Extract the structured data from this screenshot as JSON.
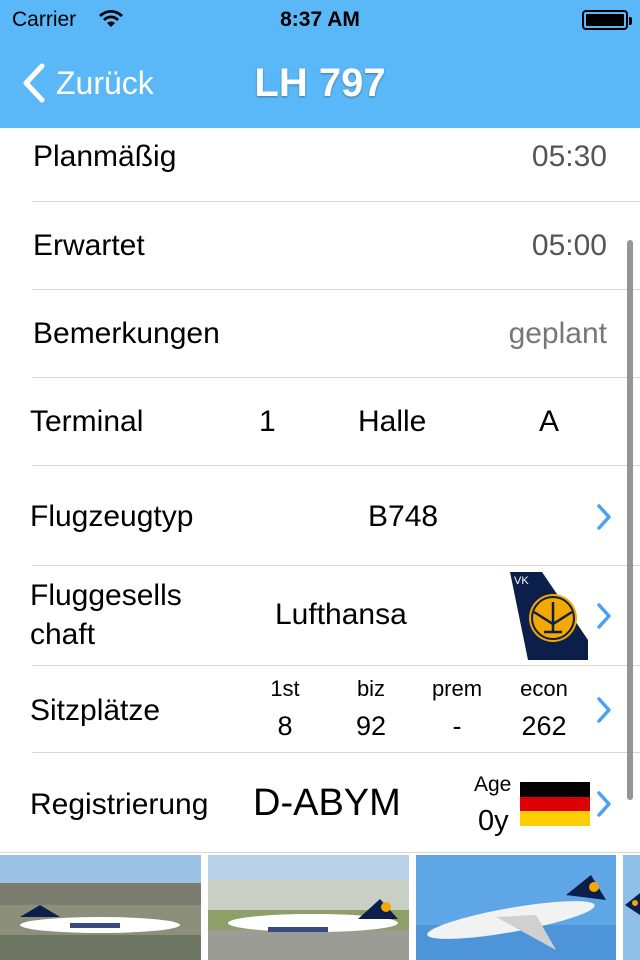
{
  "status_bar": {
    "carrier": "Carrier",
    "time": "8:37 AM"
  },
  "nav": {
    "back_label": "Zurück",
    "title": "LH 797"
  },
  "rows": {
    "scheduled": {
      "label": "Planmäßig",
      "value": "05:30"
    },
    "expected": {
      "label": "Erwartet",
      "value": "05:00"
    },
    "remarks": {
      "label": "Bemerkungen",
      "value": "geplant"
    },
    "terminal": {
      "label": "Terminal",
      "value": "1",
      "hall_label": "Halle",
      "hall_value": "A"
    },
    "aircraft_type": {
      "label": "Flugzeugtyp",
      "value": "B748"
    },
    "airline": {
      "label_line1": "Fluggesells",
      "label_line2": "chaft",
      "value": "Lufthansa"
    },
    "seats": {
      "label": "Sitzplätze",
      "classes": [
        {
          "name": "1st",
          "count": "8"
        },
        {
          "name": "biz",
          "count": "92"
        },
        {
          "name": "prem",
          "count": "-"
        },
        {
          "name": "econ",
          "count": "262"
        }
      ]
    },
    "registration": {
      "label": "Registrierung",
      "value": "D-ABYM",
      "age_label": "Age",
      "age_value": "0y"
    }
  },
  "tail_logo": {
    "tail_text": "VK"
  },
  "icons": {
    "back": "chevron-left-icon",
    "disclosure": "chevron-right-icon",
    "wifi": "wifi-icon",
    "battery": "battery-icon",
    "airline_logo": "lufthansa-tail-logo",
    "flag": "germany-flag-icon"
  },
  "colors": {
    "nav_bar": "#5ab8f8",
    "disclosure": "#4aa3f0",
    "lufthansa_blue": "#0b1f4a",
    "lufthansa_yellow": "#f5a800"
  },
  "photos": [
    {
      "name": "photo-1"
    },
    {
      "name": "photo-2"
    },
    {
      "name": "photo-3"
    },
    {
      "name": "photo-4"
    }
  ]
}
